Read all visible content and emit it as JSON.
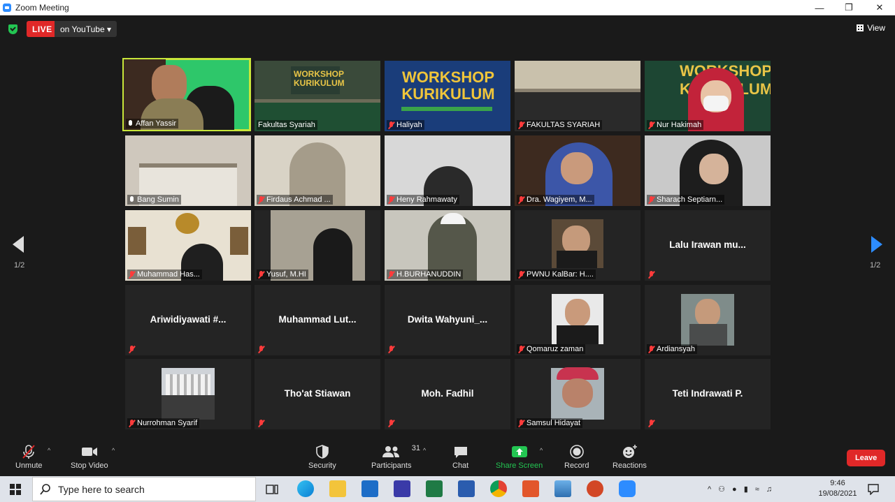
{
  "window": {
    "title": "Zoom Meeting"
  },
  "header": {
    "live_label": "LIVE",
    "stream_label": "on YouTube",
    "view_label": "View"
  },
  "pager": {
    "left": "1/2",
    "right": "1/2"
  },
  "tiles": [
    {
      "name": "Affan Yassir",
      "muted": false,
      "video": true
    },
    {
      "name": "Fakultas Syariah",
      "muted": false,
      "video": true
    },
    {
      "name": "Haliyah",
      "muted": true,
      "video": true
    },
    {
      "name": "FAKULTAS SYARIAH",
      "muted": true,
      "video": true
    },
    {
      "name": "Nur Hakimah",
      "muted": true,
      "video": true
    },
    {
      "name": "Bang Sumin",
      "muted": false,
      "video": true
    },
    {
      "name": "Firdaus Achmad ...",
      "muted": true,
      "video": true
    },
    {
      "name": "Heny Rahmawaty",
      "muted": true,
      "video": true
    },
    {
      "name": "Dra. Wagiyem, M...",
      "muted": true,
      "video": true
    },
    {
      "name": "Sharach Septiarn...",
      "muted": true,
      "video": true
    },
    {
      "name": "Muhammad Has...",
      "muted": true,
      "video": true
    },
    {
      "name": "Yusuf, M.HI",
      "muted": true,
      "video": true
    },
    {
      "name": "H.BURHANUDDIN",
      "muted": true,
      "video": true
    },
    {
      "name": "PWNU KalBar: H....",
      "muted": true,
      "video": false
    },
    {
      "name": "",
      "bigname": "Lalu Irawan mu...",
      "muted": true,
      "video": false
    },
    {
      "name": "",
      "bigname": "Ariwidiyawati #...",
      "muted": true,
      "video": false
    },
    {
      "name": "",
      "bigname": "Muhammad Lut...",
      "muted": true,
      "video": false
    },
    {
      "name": "",
      "bigname": "Dwita Wahyuni_...",
      "muted": true,
      "video": false
    },
    {
      "name": "Qomaruz zaman",
      "muted": true,
      "video": false
    },
    {
      "name": "Ardiansyah",
      "muted": true,
      "video": false
    },
    {
      "name": "Nurrohman Syarif",
      "muted": true,
      "video": false
    },
    {
      "name": "",
      "bigname": "Tho'at Stiawan",
      "muted": true,
      "video": false
    },
    {
      "name": "",
      "bigname": "Moh. Fadhil",
      "muted": true,
      "video": false
    },
    {
      "name": "Samsul Hidayat",
      "muted": true,
      "video": false
    },
    {
      "name": "",
      "bigname": "Teti Indrawati P.",
      "muted": true,
      "video": false
    }
  ],
  "workshop": {
    "line1": "WORKSHOP",
    "line2": "KURIKULUM"
  },
  "toolbar": {
    "unmute": "Unmute",
    "stop_video": "Stop Video",
    "security": "Security",
    "participants": "Participants",
    "participants_count": "31",
    "chat": "Chat",
    "share_screen": "Share Screen",
    "record": "Record",
    "reactions": "Reactions",
    "leave": "Leave"
  },
  "taskbar": {
    "search_placeholder": "Type here to search",
    "time": "9:46",
    "date": "19/08/2021"
  },
  "colors": {
    "accent": "#2d8cff",
    "live": "#e02828",
    "active_speaker": "#c8e63a",
    "share": "#23c552"
  }
}
